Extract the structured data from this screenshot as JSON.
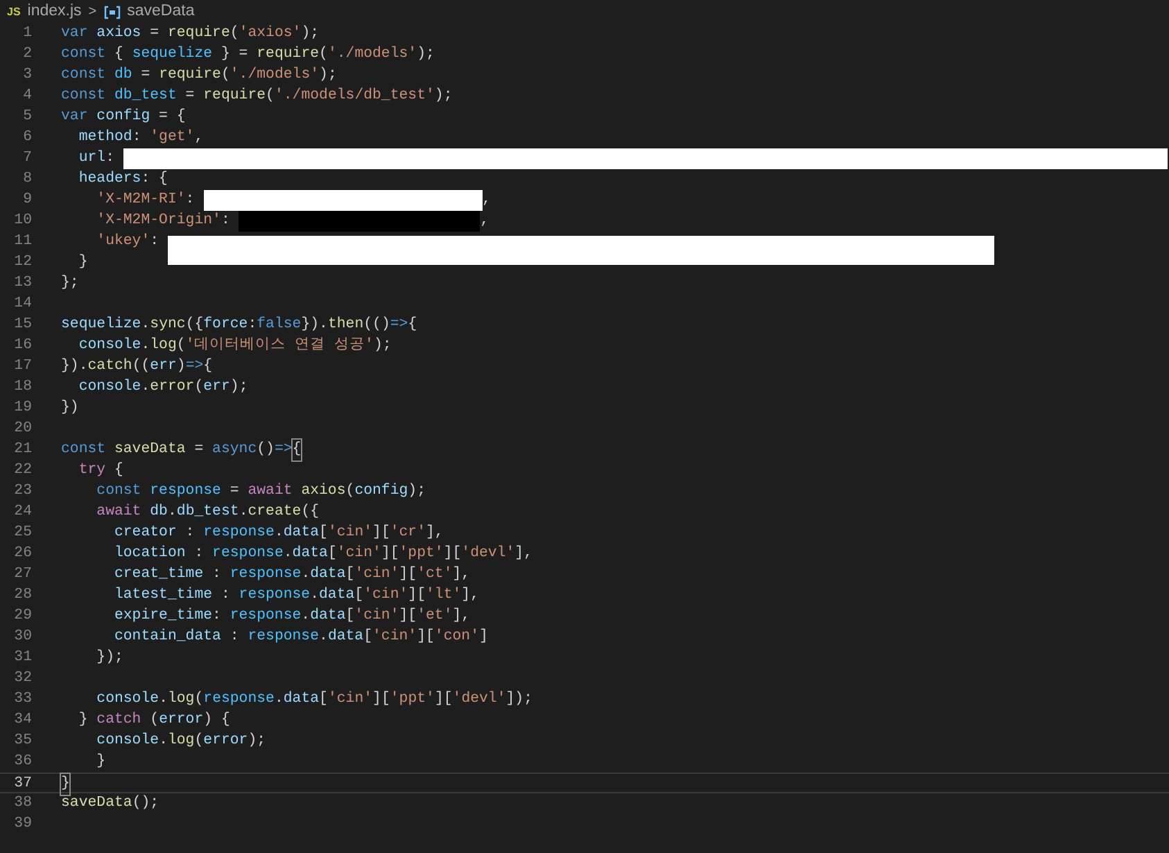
{
  "breadcrumb": {
    "file_badge": "JS",
    "file": "index.js",
    "separator": ">",
    "symbol": "saveData"
  },
  "lines": [
    {
      "number": "1",
      "current": false,
      "tokens": [
        {
          "kind": "keyword",
          "text": "var "
        },
        {
          "kind": "variable",
          "text": "axios"
        },
        {
          "kind": "plain",
          "text": " = "
        },
        {
          "kind": "function",
          "text": "require"
        },
        {
          "kind": "plain",
          "text": "("
        },
        {
          "kind": "string",
          "text": "'axios'"
        },
        {
          "kind": "plain",
          "text": ");"
        }
      ]
    },
    {
      "number": "2",
      "current": false,
      "tokens": [
        {
          "kind": "keyword",
          "text": "const "
        },
        {
          "kind": "plain",
          "text": "{ "
        },
        {
          "kind": "constant",
          "text": "sequelize"
        },
        {
          "kind": "plain",
          "text": " } = "
        },
        {
          "kind": "function",
          "text": "require"
        },
        {
          "kind": "plain",
          "text": "("
        },
        {
          "kind": "string",
          "text": "'./models'"
        },
        {
          "kind": "plain",
          "text": ");"
        }
      ]
    },
    {
      "number": "3",
      "current": false,
      "tokens": [
        {
          "kind": "keyword",
          "text": "const "
        },
        {
          "kind": "constant",
          "text": "db"
        },
        {
          "kind": "plain",
          "text": " = "
        },
        {
          "kind": "function",
          "text": "require"
        },
        {
          "kind": "plain",
          "text": "("
        },
        {
          "kind": "string",
          "text": "'./models'"
        },
        {
          "kind": "plain",
          "text": ");"
        }
      ]
    },
    {
      "number": "4",
      "current": false,
      "tokens": [
        {
          "kind": "keyword",
          "text": "const "
        },
        {
          "kind": "constant",
          "text": "db_test"
        },
        {
          "kind": "plain",
          "text": " = "
        },
        {
          "kind": "function",
          "text": "require"
        },
        {
          "kind": "plain",
          "text": "("
        },
        {
          "kind": "string",
          "text": "'./models/db_test'"
        },
        {
          "kind": "plain",
          "text": ");"
        }
      ]
    },
    {
      "number": "5",
      "current": false,
      "tokens": [
        {
          "kind": "keyword",
          "text": "var "
        },
        {
          "kind": "variable",
          "text": "config"
        },
        {
          "kind": "plain",
          "text": " = {"
        }
      ]
    },
    {
      "number": "6",
      "current": false,
      "tokens": [
        {
          "kind": "variable",
          "text": "  method"
        },
        {
          "kind": "plain",
          "text": ": "
        },
        {
          "kind": "string",
          "text": "'get'"
        },
        {
          "kind": "plain",
          "text": ","
        }
      ]
    },
    {
      "number": "7",
      "current": false,
      "tokens": [
        {
          "kind": "variable",
          "text": "  url"
        },
        {
          "kind": "plain",
          "text": ": "
        },
        {
          "kind": "redacted"
        }
      ]
    },
    {
      "number": "8",
      "current": false,
      "tokens": [
        {
          "kind": "variable",
          "text": "  headers"
        },
        {
          "kind": "plain",
          "text": ": {"
        }
      ]
    },
    {
      "number": "9",
      "current": false,
      "tokens": [
        {
          "kind": "string",
          "text": "    'X-M2M-RI'"
        },
        {
          "kind": "plain",
          "text": ": "
        },
        {
          "kind": "redacted"
        },
        {
          "kind": "plain",
          "text": ","
        }
      ]
    },
    {
      "number": "10",
      "current": false,
      "tokens": [
        {
          "kind": "string",
          "text": "    'X-M2M-Origin'"
        },
        {
          "kind": "plain",
          "text": ": "
        },
        {
          "kind": "masked"
        },
        {
          "kind": "plain",
          "text": ","
        }
      ]
    },
    {
      "number": "11",
      "current": false,
      "tokens": [
        {
          "kind": "string",
          "text": "    'ukey'"
        },
        {
          "kind": "plain",
          "text": ": "
        },
        {
          "kind": "redacted"
        }
      ]
    },
    {
      "number": "12",
      "current": false,
      "tokens": [
        {
          "kind": "plain",
          "text": "  }"
        }
      ]
    },
    {
      "number": "13",
      "current": false,
      "tokens": [
        {
          "kind": "plain",
          "text": "};"
        }
      ]
    },
    {
      "number": "14",
      "current": false
    },
    {
      "number": "15",
      "current": false,
      "tokens": [
        {
          "kind": "variable",
          "text": "sequelize"
        },
        {
          "kind": "plain",
          "text": "."
        },
        {
          "kind": "function",
          "text": "sync"
        },
        {
          "kind": "plain",
          "text": "({"
        },
        {
          "kind": "variable",
          "text": "force"
        },
        {
          "kind": "plain",
          "text": ":"
        },
        {
          "kind": "keyword",
          "text": "false"
        },
        {
          "kind": "plain",
          "text": "})."
        },
        {
          "kind": "function",
          "text": "then"
        },
        {
          "kind": "plain",
          "text": "(()"
        },
        {
          "kind": "keyword",
          "text": "=>"
        },
        {
          "kind": "plain",
          "text": "{"
        }
      ]
    },
    {
      "number": "16",
      "current": false,
      "tokens": [
        {
          "kind": "variable",
          "text": "  console"
        },
        {
          "kind": "function",
          "text": ".log"
        },
        {
          "kind": "plain",
          "text": "("
        },
        {
          "kind": "string",
          "text": "'데이터베이스 연결 성공'"
        },
        {
          "kind": "plain",
          "text": ");"
        }
      ]
    },
    {
      "number": "17",
      "current": false,
      "tokens": [
        {
          "kind": "plain",
          "text": "})."
        },
        {
          "kind": "function",
          "text": "catch"
        },
        {
          "kind": "plain",
          "text": "(("
        },
        {
          "kind": "variable",
          "text": "err"
        },
        {
          "kind": "plain",
          "text": ")"
        },
        {
          "kind": "keyword",
          "text": "=>"
        },
        {
          "kind": "plain",
          "text": "{"
        }
      ]
    },
    {
      "number": "18",
      "current": false,
      "tokens": [
        {
          "kind": "variable",
          "text": "  console"
        },
        {
          "kind": "plain",
          "text": "."
        },
        {
          "kind": "function",
          "text": "error"
        },
        {
          "kind": "plain",
          "text": "("
        },
        {
          "kind": "variable",
          "text": "err"
        },
        {
          "kind": "plain",
          "text": ");"
        }
      ]
    },
    {
      "number": "19",
      "current": false,
      "tokens": [
        {
          "kind": "plain",
          "text": "})"
        }
      ]
    },
    {
      "number": "20",
      "current": false
    },
    {
      "number": "21",
      "current": false,
      "tokens": [
        {
          "kind": "keyword",
          "text": "const "
        },
        {
          "kind": "function",
          "text": "saveData"
        },
        {
          "kind": "plain",
          "text": " = "
        },
        {
          "kind": "keyword",
          "text": "async"
        },
        {
          "kind": "plain",
          "text": "()"
        },
        {
          "kind": "keyword",
          "text": "=>"
        },
        {
          "kind": "bracket",
          "text": "{"
        }
      ]
    },
    {
      "number": "22",
      "current": false,
      "tokens": [
        {
          "kind": "control",
          "text": "  try"
        },
        {
          "kind": "plain",
          "text": " {"
        }
      ]
    },
    {
      "number": "23",
      "current": false,
      "tokens": [
        {
          "kind": "keyword",
          "text": "    const "
        },
        {
          "kind": "constant",
          "text": "response"
        },
        {
          "kind": "plain",
          "text": " = "
        },
        {
          "kind": "control",
          "text": "await"
        },
        {
          "kind": "function",
          "text": " axios"
        },
        {
          "kind": "plain",
          "text": "("
        },
        {
          "kind": "variable",
          "text": "config"
        },
        {
          "kind": "plain",
          "text": ");"
        }
      ]
    },
    {
      "number": "24",
      "current": false,
      "tokens": [
        {
          "kind": "control",
          "text": "    await"
        },
        {
          "kind": "variable",
          "text": " db"
        },
        {
          "kind": "plain",
          "text": "."
        },
        {
          "kind": "variable",
          "text": "db_test"
        },
        {
          "kind": "plain",
          "text": "."
        },
        {
          "kind": "function",
          "text": "create"
        },
        {
          "kind": "plain",
          "text": "({"
        }
      ]
    },
    {
      "number": "25",
      "current": false,
      "tokens": [
        {
          "kind": "variable",
          "text": "      creator"
        },
        {
          "kind": "plain",
          "text": " : "
        },
        {
          "kind": "constant",
          "text": "response"
        },
        {
          "kind": "plain",
          "text": "."
        },
        {
          "kind": "variable",
          "text": "data"
        },
        {
          "kind": "plain",
          "text": "["
        },
        {
          "kind": "string",
          "text": "'cin'"
        },
        {
          "kind": "plain",
          "text": "]["
        },
        {
          "kind": "string",
          "text": "'cr'"
        },
        {
          "kind": "plain",
          "text": "],"
        }
      ]
    },
    {
      "number": "26",
      "current": false,
      "tokens": [
        {
          "kind": "variable",
          "text": "      location"
        },
        {
          "kind": "plain",
          "text": " : "
        },
        {
          "kind": "constant",
          "text": "response"
        },
        {
          "kind": "plain",
          "text": "."
        },
        {
          "kind": "variable",
          "text": "data"
        },
        {
          "kind": "plain",
          "text": "["
        },
        {
          "kind": "string",
          "text": "'cin'"
        },
        {
          "kind": "plain",
          "text": "]["
        },
        {
          "kind": "string",
          "text": "'ppt'"
        },
        {
          "kind": "plain",
          "text": "]["
        },
        {
          "kind": "string",
          "text": "'devl'"
        },
        {
          "kind": "plain",
          "text": "],"
        }
      ]
    },
    {
      "number": "27",
      "current": false,
      "tokens": [
        {
          "kind": "variable",
          "text": "      creat_time"
        },
        {
          "kind": "plain",
          "text": " : "
        },
        {
          "kind": "constant",
          "text": "response"
        },
        {
          "kind": "plain",
          "text": "."
        },
        {
          "kind": "variable",
          "text": "data"
        },
        {
          "kind": "plain",
          "text": "["
        },
        {
          "kind": "string",
          "text": "'cin'"
        },
        {
          "kind": "plain",
          "text": "]["
        },
        {
          "kind": "string",
          "text": "'ct'"
        },
        {
          "kind": "plain",
          "text": "],"
        }
      ]
    },
    {
      "number": "28",
      "current": false,
      "tokens": [
        {
          "kind": "variable",
          "text": "      latest_time"
        },
        {
          "kind": "plain",
          "text": " : "
        },
        {
          "kind": "constant",
          "text": "response"
        },
        {
          "kind": "plain",
          "text": "."
        },
        {
          "kind": "variable",
          "text": "data"
        },
        {
          "kind": "plain",
          "text": "["
        },
        {
          "kind": "string",
          "text": "'cin'"
        },
        {
          "kind": "plain",
          "text": "]["
        },
        {
          "kind": "string",
          "text": "'lt'"
        },
        {
          "kind": "plain",
          "text": "],"
        }
      ]
    },
    {
      "number": "29",
      "current": false,
      "tokens": [
        {
          "kind": "variable",
          "text": "      expire_time"
        },
        {
          "kind": "plain",
          "text": ": "
        },
        {
          "kind": "constant",
          "text": "response"
        },
        {
          "kind": "plain",
          "text": "."
        },
        {
          "kind": "variable",
          "text": "data"
        },
        {
          "kind": "plain",
          "text": "["
        },
        {
          "kind": "string",
          "text": "'cin'"
        },
        {
          "kind": "plain",
          "text": "]["
        },
        {
          "kind": "string",
          "text": "'et'"
        },
        {
          "kind": "plain",
          "text": "],"
        }
      ]
    },
    {
      "number": "30",
      "current": false,
      "tokens": [
        {
          "kind": "variable",
          "text": "      contain_data"
        },
        {
          "kind": "plain",
          "text": " : "
        },
        {
          "kind": "constant",
          "text": "response"
        },
        {
          "kind": "plain",
          "text": "."
        },
        {
          "kind": "variable",
          "text": "data"
        },
        {
          "kind": "plain",
          "text": "["
        },
        {
          "kind": "string",
          "text": "'cin'"
        },
        {
          "kind": "plain",
          "text": "]["
        },
        {
          "kind": "string",
          "text": "'con'"
        },
        {
          "kind": "plain",
          "text": "]"
        }
      ]
    },
    {
      "number": "31",
      "current": false,
      "tokens": [
        {
          "kind": "plain",
          "text": "    });"
        }
      ]
    },
    {
      "number": "32",
      "current": false
    },
    {
      "number": "33",
      "current": false,
      "tokens": [
        {
          "kind": "variable",
          "text": "    console"
        },
        {
          "kind": "plain",
          "text": "."
        },
        {
          "kind": "function",
          "text": "log"
        },
        {
          "kind": "plain",
          "text": "("
        },
        {
          "kind": "constant",
          "text": "response"
        },
        {
          "kind": "plain",
          "text": "."
        },
        {
          "kind": "variable",
          "text": "data"
        },
        {
          "kind": "plain",
          "text": "["
        },
        {
          "kind": "string",
          "text": "'cin'"
        },
        {
          "kind": "plain",
          "text": "]["
        },
        {
          "kind": "string",
          "text": "'ppt'"
        },
        {
          "kind": "plain",
          "text": "]["
        },
        {
          "kind": "string",
          "text": "'devl'"
        },
        {
          "kind": "plain",
          "text": "]);"
        }
      ]
    },
    {
      "number": "34",
      "current": false,
      "tokens": [
        {
          "kind": "plain",
          "text": "  } "
        },
        {
          "kind": "control",
          "text": "catch"
        },
        {
          "kind": "plain",
          "text": " ("
        },
        {
          "kind": "variable",
          "text": "error"
        },
        {
          "kind": "plain",
          "text": ") {"
        }
      ]
    },
    {
      "number": "35",
      "current": false,
      "tokens": [
        {
          "kind": "variable",
          "text": "    console"
        },
        {
          "kind": "plain",
          "text": "."
        },
        {
          "kind": "function",
          "text": "log"
        },
        {
          "kind": "plain",
          "text": "("
        },
        {
          "kind": "variable",
          "text": "error"
        },
        {
          "kind": "plain",
          "text": ");"
        }
      ]
    },
    {
      "number": "36",
      "current": false,
      "tokens": [
        {
          "kind": "plain",
          "text": "    }"
        }
      ]
    },
    {
      "number": "37",
      "current": true,
      "tokens": [
        {
          "kind": "bracket",
          "text": "}"
        }
      ]
    },
    {
      "number": "38",
      "current": false,
      "tokens": [
        {
          "kind": "function",
          "text": "saveData"
        },
        {
          "kind": "plain",
          "text": "();"
        }
      ]
    },
    {
      "number": "39",
      "current": false
    }
  ]
}
